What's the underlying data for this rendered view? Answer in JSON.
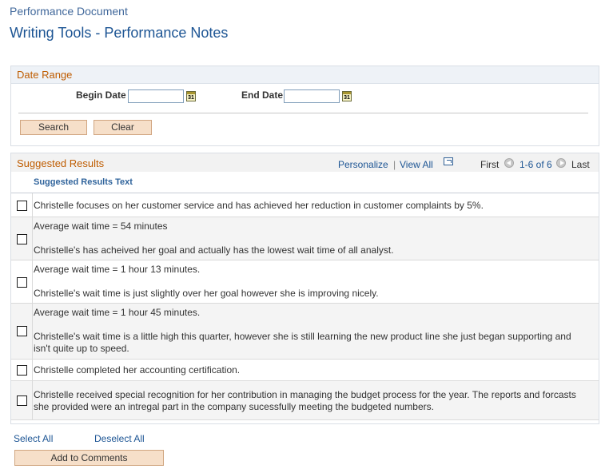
{
  "header": {
    "doc_title": "Performance Document",
    "page_title": "Writing Tools - Performance Notes"
  },
  "date_range": {
    "label": "Date Range",
    "begin_label": "Begin Date",
    "begin_value": "",
    "end_label": "End Date",
    "end_value": "",
    "calendar_glyph": "31",
    "search_label": "Search",
    "clear_label": "Clear"
  },
  "results": {
    "label": "Suggested Results",
    "personalize": "Personalize",
    "separator": "|",
    "view_all": "View All",
    "first": "First",
    "range": "1-6 of 6",
    "last": "Last",
    "column_header": "Suggested Results Text",
    "rows": [
      {
        "checked": false,
        "lines": [
          "Christelle focuses on her customer service and has achieved her reduction in customer complaints by 5%."
        ]
      },
      {
        "checked": false,
        "lines": [
          "Average wait time =  54 minutes",
          "",
          "Christelle's has acheived her goal and actually has the lowest wait time of all analyst."
        ]
      },
      {
        "checked": false,
        "lines": [
          "Average wait time = 1 hour 13 minutes.",
          "",
          "Christelle's wait time is just slightly over her goal however she is improving nicely."
        ]
      },
      {
        "checked": false,
        "lines": [
          "Average wait time = 1 hour 45 minutes.",
          "",
          "Christelle's wait time is a little high this quarter, however she is still learning the new product line she just began supporting and",
          "isn't quite up to speed."
        ]
      },
      {
        "checked": false,
        "lines": [
          "Christelle completed her accounting certification."
        ]
      },
      {
        "checked": false,
        "lines": [
          "Christelle received special recognition for her contribution in managing the budget process for the year.  The reports and forcasts",
          "she provided were an intregal part in the company sucessfully meeting the budgeted numbers."
        ]
      }
    ]
  },
  "footer": {
    "select_all": "Select All",
    "deselect_all": "Deselect All",
    "add_to_comments": "Add to Comments"
  }
}
